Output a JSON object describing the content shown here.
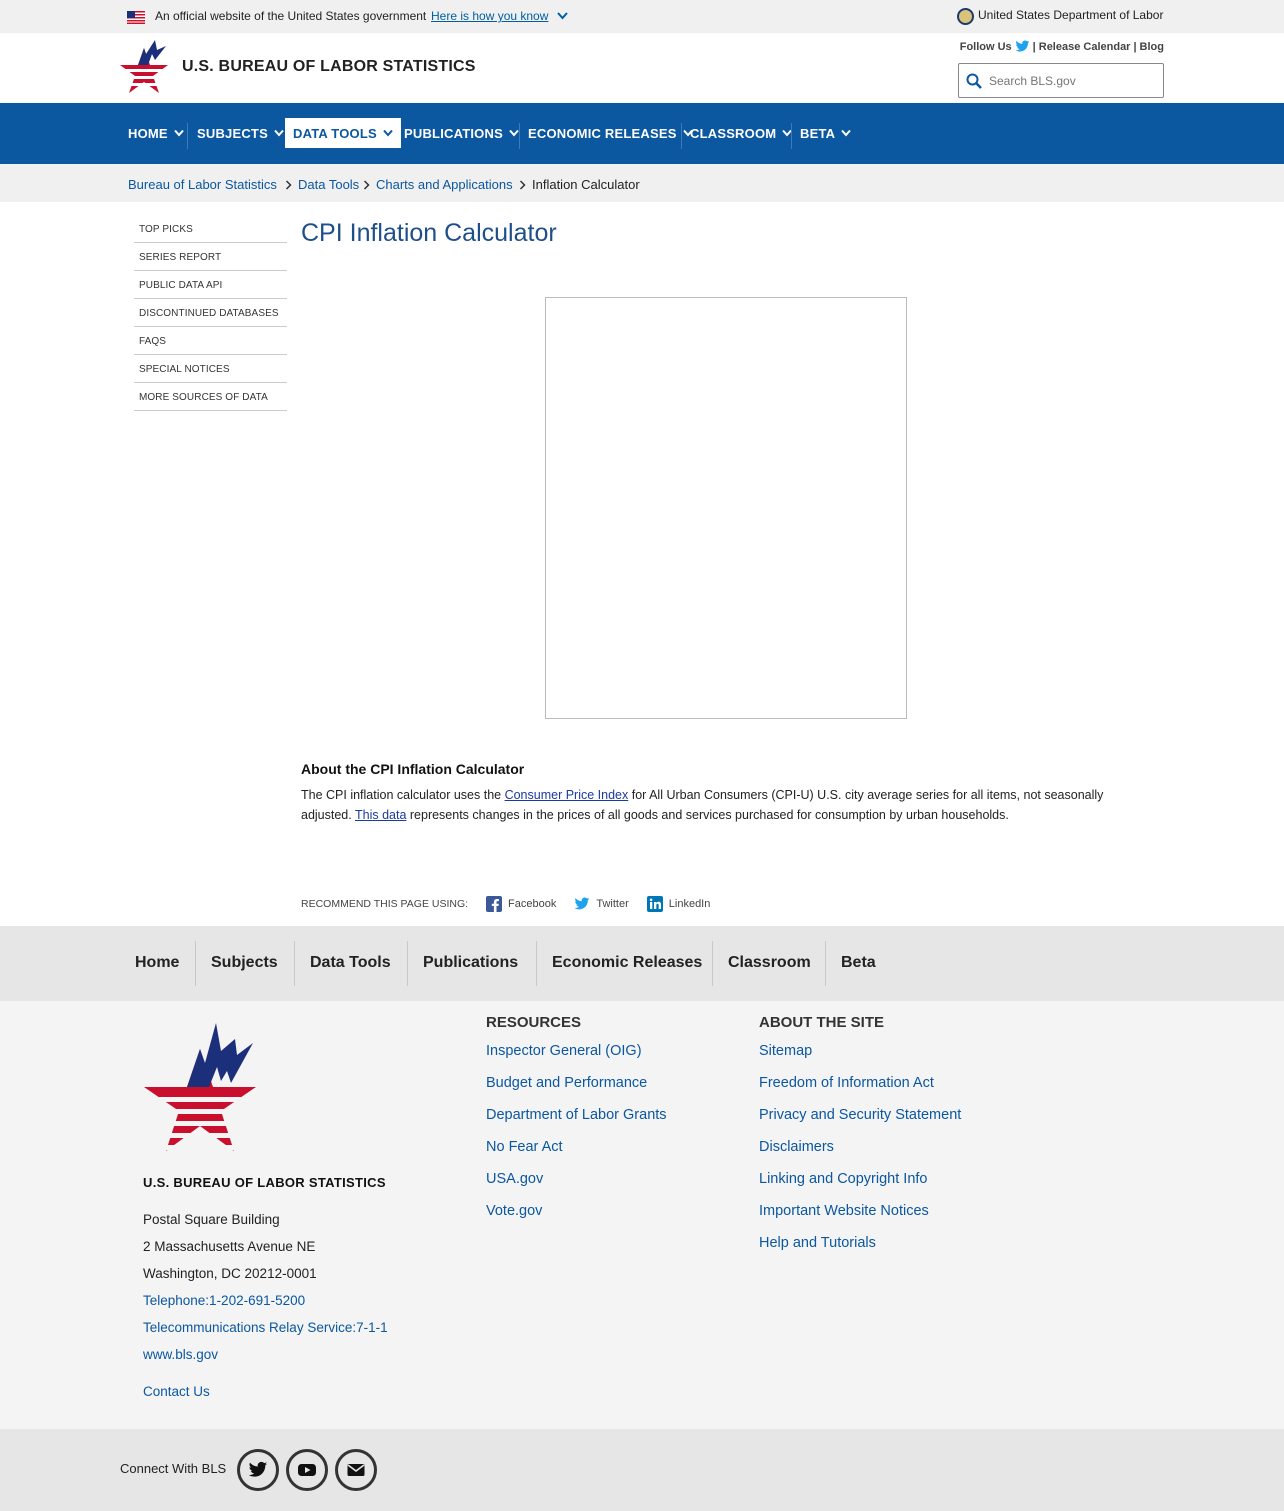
{
  "gov_banner": {
    "text": "An official website of the United States government",
    "link": "Here is how you know",
    "department": "United States Department of Labor"
  },
  "header": {
    "site_title": "U.S. BUREAU OF LABOR STATISTICS",
    "follow_label": "Follow Us",
    "sep1": "|",
    "release_calendar": "Release Calendar",
    "sep2": "|",
    "blog": "Blog",
    "search_placeholder": "Search BLS.gov"
  },
  "nav": {
    "items": [
      "HOME",
      "SUBJECTS",
      "DATA TOOLS",
      "PUBLICATIONS",
      "ECONOMIC RELEASES",
      "CLASSROOM",
      "BETA"
    ],
    "active": "DATA TOOLS"
  },
  "breadcrumb": [
    "Bureau of Labor Statistics",
    "Data Tools",
    "Charts and Applications",
    "Inflation Calculator"
  ],
  "sidebar": [
    "TOP PICKS",
    "SERIES REPORT",
    "PUBLIC DATA API",
    "DISCONTINUED DATABASES",
    "FAQS",
    "SPECIAL NOTICES",
    "MORE SOURCES OF DATA"
  ],
  "content": {
    "title": "CPI Inflation Calculator",
    "about_title": "About the CPI Inflation Calculator",
    "about_p1": "The CPI inflation calculator uses the ",
    "about_link1": "Consumer Price Index",
    "about_p2": " for All Urban Consumers (CPI-U) U.S. city average series for all items, not seasonally adjusted. ",
    "about_link2": "This data",
    "about_p3": " represents changes in the prices of all goods and services purchased for consumption by urban households.",
    "recommend_label": "RECOMMEND THIS PAGE USING:",
    "share": [
      "Facebook",
      "Twitter",
      "LinkedIn"
    ]
  },
  "footer_nav": [
    "Home",
    "Subjects",
    "Data Tools",
    "Publications",
    "Economic Releases",
    "Classroom",
    "Beta"
  ],
  "footer": {
    "org": "U.S. BUREAU OF LABOR STATISTICS",
    "address1": "Postal Square Building",
    "address2": "2 Massachusetts Avenue NE",
    "address3": "Washington, DC 20212-0001",
    "telephone": "Telephone:1-202-691-5200",
    "relay": "Telecommunications Relay Service:7-1-1",
    "website": "www.bls.gov",
    "contact": "Contact Us",
    "resources_title": "RESOURCES",
    "resources": [
      "Inspector General (OIG)",
      "Budget and Performance",
      "Department of Labor Grants",
      "No Fear Act",
      "USA.gov",
      "Vote.gov"
    ],
    "about_title": "ABOUT THE SITE",
    "about_links": [
      "Sitemap",
      "Freedom of Information Act",
      "Privacy and Security Statement",
      "Disclaimers",
      "Linking and Copyright Info",
      "Important Website Notices",
      "Help and Tutorials"
    ]
  },
  "connect": {
    "label": "Connect With BLS",
    "icons": [
      "twitter-icon",
      "youtube-icon",
      "email-icon"
    ]
  },
  "colors": {
    "nav_blue": "#0b57a0",
    "title_blue": "#1f4f8a",
    "star_red": "#c8102e",
    "star_navy": "#1c2f7a"
  }
}
